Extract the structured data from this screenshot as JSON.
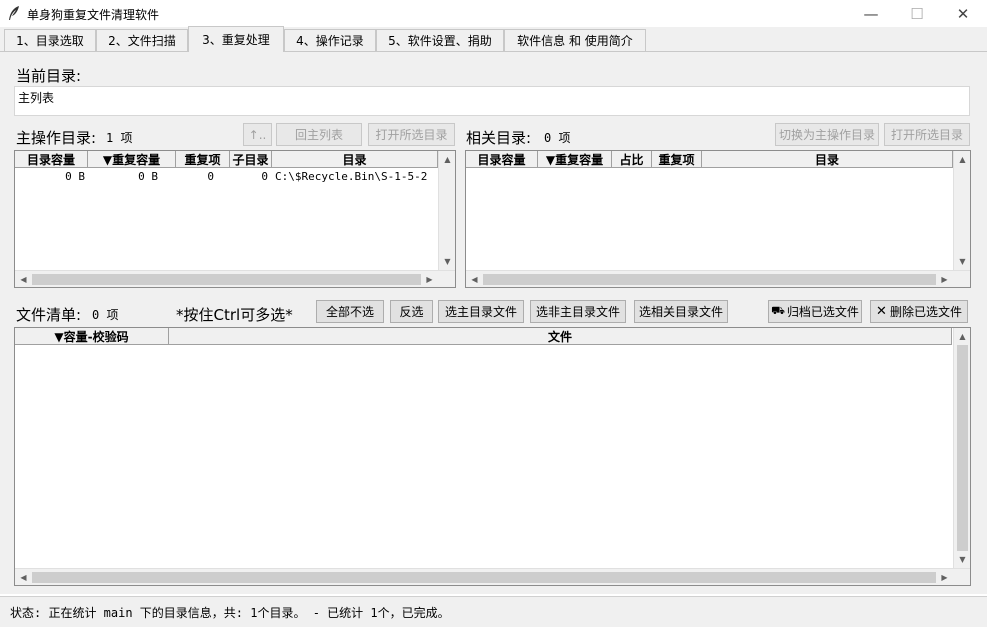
{
  "window": {
    "title": "单身狗重复文件清理软件"
  },
  "tabs": [
    {
      "label": "1、目录选取"
    },
    {
      "label": "2、文件扫描"
    },
    {
      "label": "3、重复处理"
    },
    {
      "label": "4、操作记录"
    },
    {
      "label": "5、软件设置、捐助"
    },
    {
      "label": "软件信息 和 使用简介"
    }
  ],
  "current_dir": {
    "label": "当前目录:",
    "value": "主列表"
  },
  "main_dir": {
    "label": "主操作目录:",
    "count": "1 项",
    "buttons": {
      "up": "↑..",
      "back": "回主列表",
      "open": "打开所选目录"
    },
    "columns": [
      "目录容量",
      "▼重复容量",
      "重复项",
      "子目录",
      "目录"
    ],
    "rows": [
      {
        "size": "0 B",
        "dup_size": "0 B",
        "dup_items": "0",
        "subdirs": "0",
        "path": "C:\\$Recycle.Bin\\S-1-5-2"
      }
    ]
  },
  "related_dir": {
    "label": "相关目录:",
    "count": "0 项",
    "buttons": {
      "switch": "切换为主操作目录",
      "open": "打开所选目录"
    },
    "columns": [
      "目录容量",
      "▼重复容量",
      "占比",
      "重复项",
      "目录"
    ]
  },
  "file_list": {
    "label": "文件清单:",
    "count": "0 项",
    "hint": "*按住Ctrl可多选*",
    "buttons": {
      "deselect": "全部不选",
      "invert": "反选",
      "select_main": "选主目录文件",
      "select_non_main": "选非主目录文件",
      "select_related": "选相关目录文件",
      "archive": "归档已选文件",
      "delete": "删除已选文件"
    },
    "columns": [
      "▼容量-校验码",
      "文件"
    ]
  },
  "status": {
    "text": "状态: 正在统计 main 下的目录信息，共: 1个目录。 - 已统计 1个，已完成。"
  }
}
